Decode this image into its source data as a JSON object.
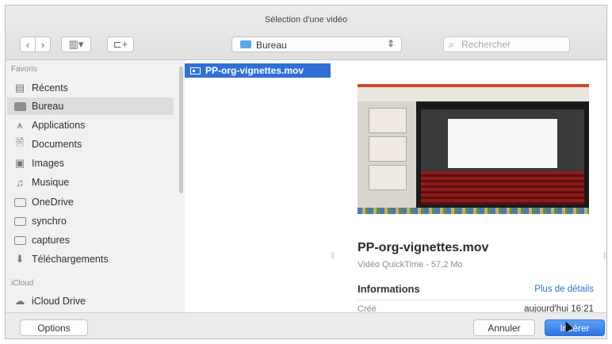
{
  "window": {
    "title": "Sélection d'une vidéo"
  },
  "toolbar": {
    "back_glyph": "‹",
    "forward_glyph": "›",
    "view_glyph": "▥▾",
    "new_folder_glyph": "⊏+",
    "location": "Bureau",
    "location_arrows": "⇕",
    "search_placeholder": "Rechercher"
  },
  "sidebar": {
    "favorites_header": "Favoris",
    "items": [
      {
        "label": "Récents",
        "icon": "clock-doc-icon",
        "selected": false
      },
      {
        "label": "Bureau",
        "icon": "desktop-folder-icon",
        "selected": true
      },
      {
        "label": "Applications",
        "icon": "applications-icon",
        "selected": false
      },
      {
        "label": "Documents",
        "icon": "documents-icon",
        "selected": false
      },
      {
        "label": "Images",
        "icon": "camera-icon",
        "selected": false
      },
      {
        "label": "Musique",
        "icon": "music-icon",
        "selected": false
      },
      {
        "label": "OneDrive",
        "icon": "folder-icon",
        "selected": false
      },
      {
        "label": "synchro",
        "icon": "folder-icon",
        "selected": false
      },
      {
        "label": "captures",
        "icon": "folder-icon",
        "selected": false
      },
      {
        "label": "Téléchargements",
        "icon": "download-icon",
        "selected": false
      }
    ],
    "icloud_header": "iCloud",
    "icloud_items": [
      {
        "label": "iCloud Drive",
        "icon": "cloud-icon"
      }
    ]
  },
  "files": [
    {
      "name": "PP-org-vignettes.mov",
      "selected": true
    }
  ],
  "preview": {
    "name": "PP-org-vignettes.mov",
    "meta": "Vidéo QuickTime - 57,2 Mo",
    "info_title": "Informations",
    "more_link": "Plus de détails",
    "created_label": "Créé",
    "created_value": "aujourd'hui 16:21"
  },
  "buttons": {
    "options": "Options",
    "cancel": "Annuler",
    "insert": "Insérer"
  },
  "colors": {
    "accent": "#2f6fd6",
    "selection": "#2f6fd6",
    "sidebar_bg": "#f1f1f1"
  }
}
